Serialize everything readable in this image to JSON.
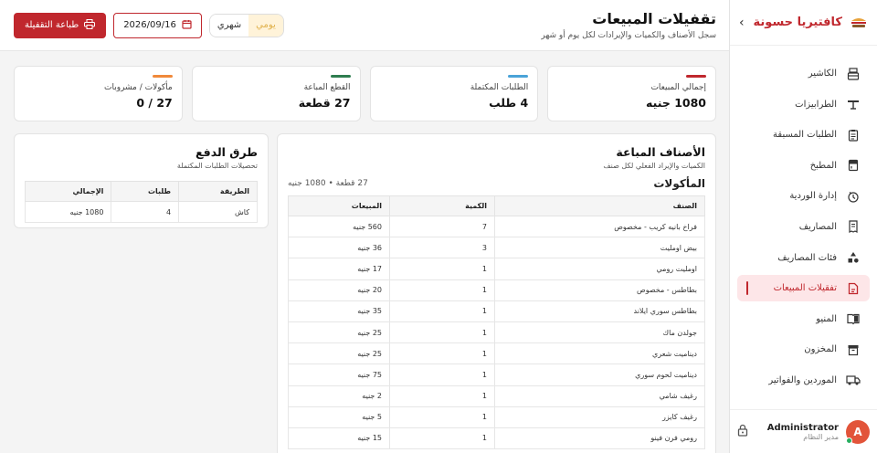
{
  "sidebar": {
    "brand": "كافتيريا حسونة",
    "collapse_icon": "chevron-right-icon",
    "items": [
      {
        "label": "الكاشير",
        "icon": "cash-register-icon",
        "active": false
      },
      {
        "label": "الطرابيزات",
        "icon": "table-icon",
        "active": false
      },
      {
        "label": "الطلبات المسبقة",
        "icon": "clipboard-icon",
        "active": false
      },
      {
        "label": "المطبخ",
        "icon": "kitchen-icon",
        "active": false
      },
      {
        "label": "إدارة الوردية",
        "icon": "shift-icon",
        "active": false
      },
      {
        "label": "المصاريف",
        "icon": "receipt-icon",
        "active": false
      },
      {
        "label": "فئات المصاريف",
        "icon": "shapes-icon",
        "active": false
      },
      {
        "label": "تفقيلات المبيعات",
        "icon": "report-icon",
        "active": true
      },
      {
        "label": "المنيو",
        "icon": "menu-book-icon",
        "active": false
      },
      {
        "label": "المخزون",
        "icon": "archive-icon",
        "active": false
      },
      {
        "label": "الموردين والفواتير",
        "icon": "truck-icon",
        "active": false
      }
    ],
    "user": {
      "initial": "A",
      "name": "Administrator",
      "role": "مدير النظام"
    }
  },
  "header": {
    "title": "تقفيلات المبيعات",
    "subtitle": "سجل الأصناف والكميات والإيرادات لكل يوم أو شهر",
    "toggle": {
      "daily": "يومي",
      "monthly": "شهري",
      "selected": "daily"
    },
    "date": "2026/09/16",
    "print_label": "طباعة التقفيلة"
  },
  "stats": [
    {
      "label": "إجمالي المبيعات",
      "value": "1080 جنيه",
      "color": "#c0272d"
    },
    {
      "label": "الطلبات المكتملة",
      "value": "4 طلب",
      "color": "#4aa3d8"
    },
    {
      "label": "القطع المباعة",
      "value": "27 قطعة",
      "color": "#2e7d4f"
    },
    {
      "label": "مأكولات / مشروبات",
      "value": "27 / 0",
      "color": "#f0893a"
    }
  ],
  "items": {
    "title": "الأصناف المباعة",
    "subtitle": "الكميات والإيراد الفعلي لكل صنف",
    "category": "المأكولات",
    "category_meta": "27 قطعة • 1080 جنيه",
    "columns": [
      "الصنف",
      "الكمية",
      "المبيعات"
    ],
    "rows": [
      [
        "فراخ بانيه كريب - مخصوص",
        "7",
        "560 جنيه"
      ],
      [
        "بيض اومليت",
        "3",
        "36 جنيه"
      ],
      [
        "اومليت رومي",
        "1",
        "17 جنيه"
      ],
      [
        "بطاطس - مخصوص",
        "1",
        "20 جنيه"
      ],
      [
        "بطاطس سوري ايلاند",
        "1",
        "35 جنيه"
      ],
      [
        "جولدن ماك",
        "1",
        "25 جنيه"
      ],
      [
        "ديناميت شعري",
        "1",
        "25 جنيه"
      ],
      [
        "ديناميت لحوم سوري",
        "1",
        "75 جنيه"
      ],
      [
        "رغيف شامي",
        "1",
        "2 جنيه"
      ],
      [
        "رغيف كايزر",
        "1",
        "5 جنيه"
      ],
      [
        "رومي فرن فينو",
        "1",
        "15 جنيه"
      ]
    ]
  },
  "payments": {
    "title": "طرق الدفع",
    "subtitle": "تحصيلات الطلبات المكتملة",
    "columns": [
      "الطريقة",
      "طلبات",
      "الإجمالي"
    ],
    "rows": [
      [
        "كاش",
        "4",
        "1080 جنيه"
      ]
    ]
  },
  "colors": {
    "accent": "#c0272d",
    "active_bg": "#fde6e8"
  }
}
